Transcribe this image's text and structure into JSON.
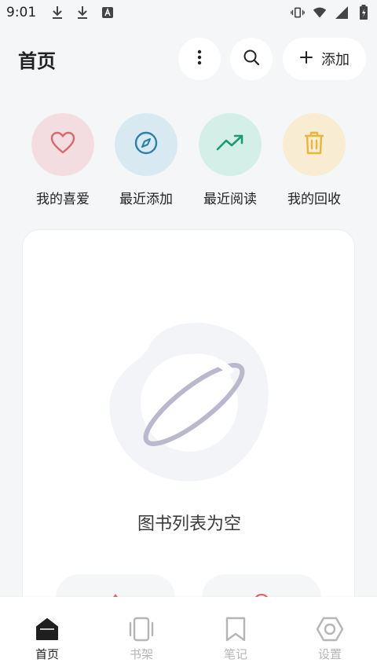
{
  "status_bar": {
    "time": "9:01",
    "left_icons": [
      "download-icon",
      "download-icon",
      "font-a-icon"
    ],
    "right_icons": [
      "vibrate-icon",
      "wifi-icon",
      "signal-icon",
      "battery-charging-icon"
    ]
  },
  "header": {
    "title": "首页",
    "more_icon": "more-vertical-icon",
    "search_icon": "search-icon",
    "add_label": "添加"
  },
  "quick_actions": [
    {
      "label": "我的喜爱",
      "icon": "heart-icon",
      "bg": "#f4dde1",
      "color": "#d9676f"
    },
    {
      "label": "最近添加",
      "icon": "compass-icon",
      "bg": "#d9e9f2",
      "color": "#2f7fab"
    },
    {
      "label": "最近阅读",
      "icon": "trending-up-icon",
      "bg": "#d3efe8",
      "color": "#1d9a72"
    },
    {
      "label": "我的回收",
      "icon": "trash-icon",
      "bg": "#f8ecd2",
      "color": "#e8b53d"
    }
  ],
  "empty_state": {
    "icon": "planet-icon",
    "text": "图书列表为空"
  },
  "bottom_nav": [
    {
      "label": "首页",
      "icon": "home-icon",
      "active": true
    },
    {
      "label": "书架",
      "icon": "bookshelf-icon",
      "active": false
    },
    {
      "label": "笔记",
      "icon": "bookmark-icon",
      "active": false
    },
    {
      "label": "设置",
      "icon": "settings-hexagon-icon",
      "active": false
    }
  ],
  "colors": {
    "background": "#f5f6f8",
    "card": "#ffffff",
    "active_nav": "#1f1f1f",
    "inactive_nav": "#b6b6b6"
  }
}
